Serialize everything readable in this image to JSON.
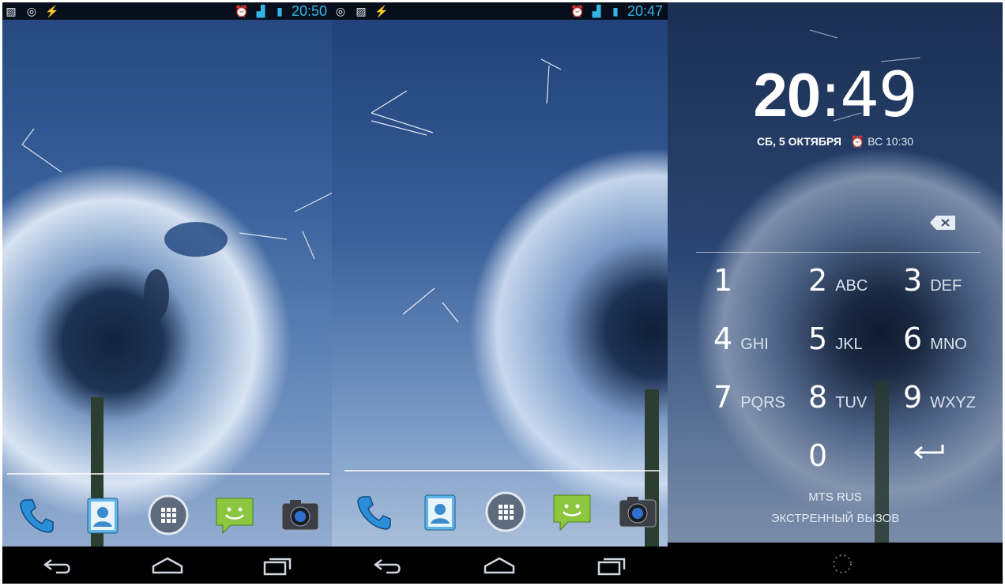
{
  "colors": {
    "accent": "#33b5e5",
    "navbar": "#000000",
    "divider": "#ffffff"
  },
  "screens": [
    {
      "status_bar": {
        "time": "20:50",
        "left_icons": [
          "image-icon",
          "target-icon",
          "bolt-icon"
        ],
        "right_icons": [
          "alarm-icon",
          "signal-icon",
          "battery-icon"
        ]
      },
      "dock": [
        "phone-app-icon",
        "contacts-app-icon",
        "app-drawer-icon",
        "messaging-app-icon",
        "camera-app-icon"
      ],
      "nav": [
        "back-icon",
        "home-icon",
        "recents-icon"
      ]
    },
    {
      "status_bar": {
        "time": "20:47",
        "left_icons": [
          "target-icon",
          "image-icon",
          "bolt-icon"
        ],
        "right_icons": [
          "alarm-icon",
          "signal-icon",
          "battery-icon"
        ]
      },
      "dock": [
        "phone-app-icon",
        "contacts-app-icon",
        "app-drawer-icon",
        "messaging-app-icon",
        "camera-app-icon"
      ],
      "nav": [
        "back-icon",
        "home-icon",
        "recents-icon"
      ]
    }
  ],
  "lockscreen": {
    "clock_hours": "20",
    "clock_minutes": ":49",
    "date": "СБ, 5 ОКТЯБРЯ",
    "alarm": "ВС 10:30",
    "keys": [
      {
        "digit": "1",
        "letters": ""
      },
      {
        "digit": "2",
        "letters": "ABC"
      },
      {
        "digit": "3",
        "letters": "DEF"
      },
      {
        "digit": "4",
        "letters": "GHI"
      },
      {
        "digit": "5",
        "letters": "JKL"
      },
      {
        "digit": "6",
        "letters": "MNO"
      },
      {
        "digit": "7",
        "letters": "PQRS"
      },
      {
        "digit": "8",
        "letters": "TUV"
      },
      {
        "digit": "9",
        "letters": "WXYZ"
      },
      {
        "digit": "0",
        "letters": ""
      }
    ],
    "carrier": "MTS RUS",
    "emergency_call": "ЭКСТРЕННЫЙ ВЫЗОВ"
  }
}
